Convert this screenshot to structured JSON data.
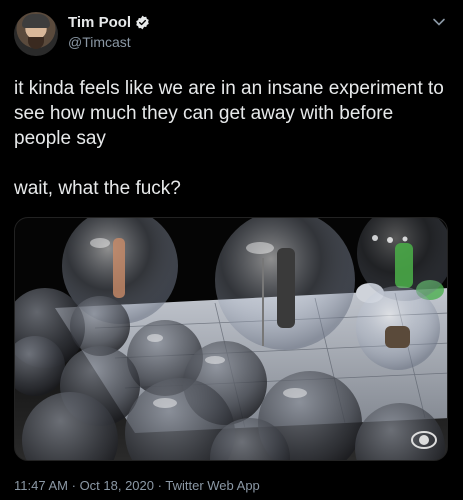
{
  "author": {
    "name": "Tim Pool",
    "handle": "@Timcast"
  },
  "tweet": {
    "text": "it kinda feels like we are in an insane experiment to see how much they can get away with before people say\n\nwait, what the fuck?"
  },
  "footer": {
    "time": "11:47 AM",
    "separator": "·",
    "date": "Oct 18, 2020",
    "source": "Twitter Web App"
  },
  "icons": {
    "verified": "verified-badge-icon",
    "menu": "chevron-down-icon",
    "watermark": "cbs-eye-icon"
  },
  "colors": {
    "background": "#000000",
    "text": "#e7e9ea",
    "secondary": "#8b98a5"
  }
}
